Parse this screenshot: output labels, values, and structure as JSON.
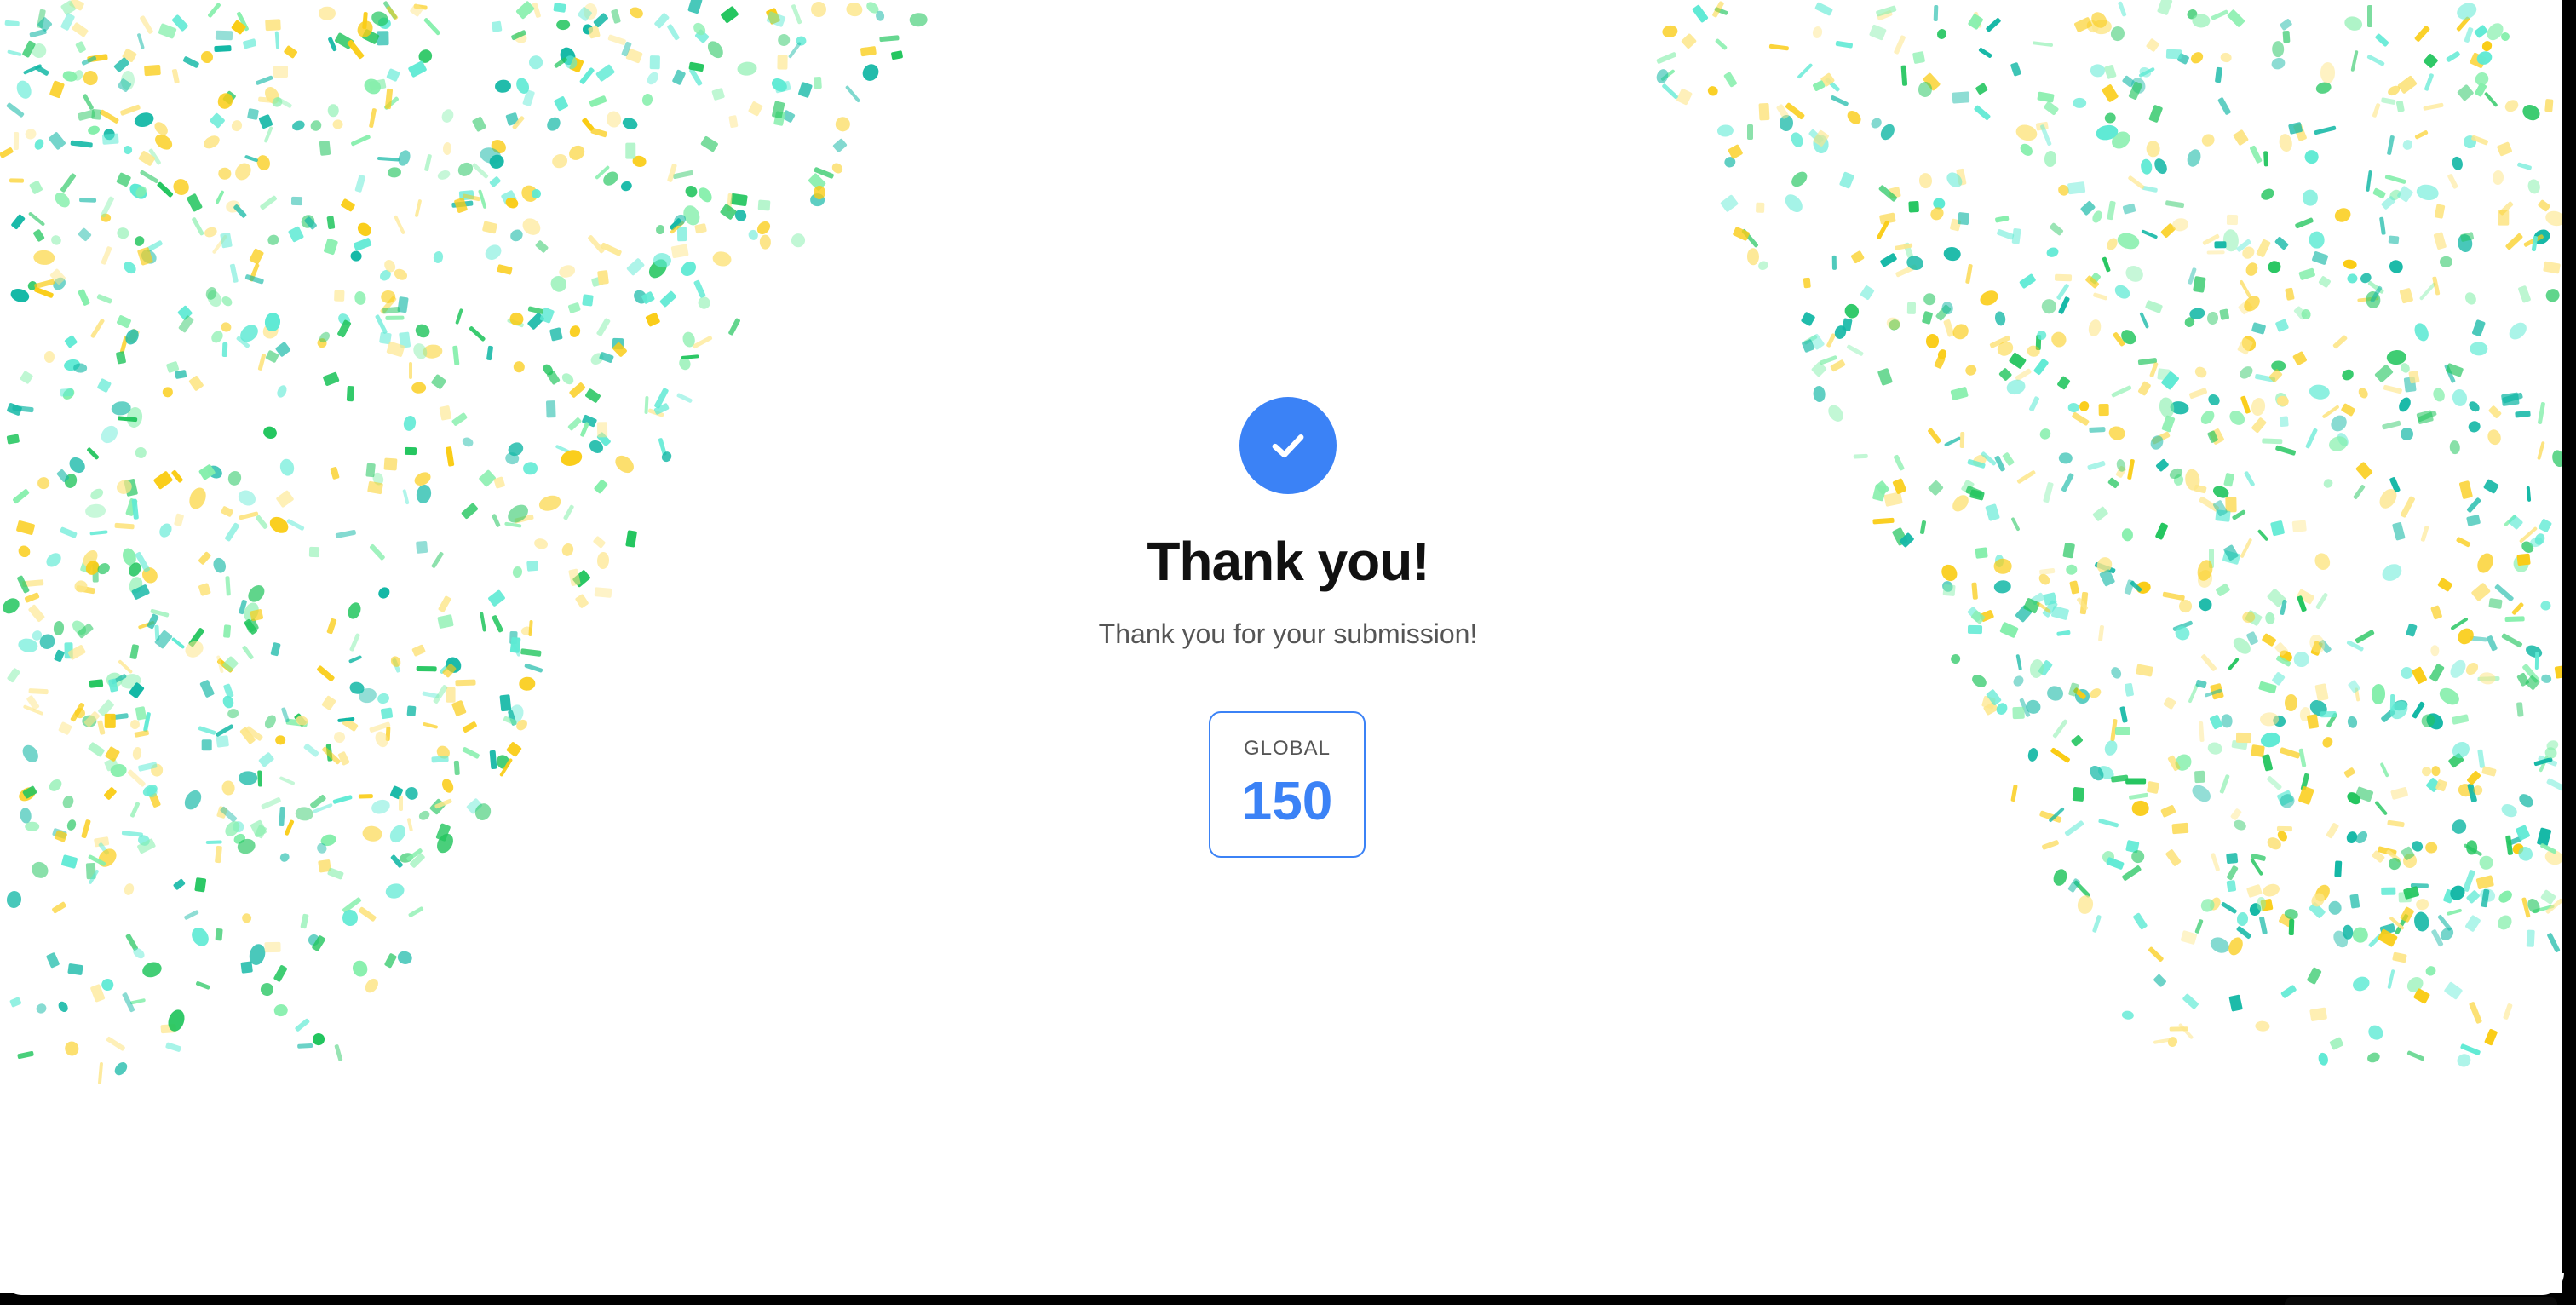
{
  "icons": {
    "success": "check-icon"
  },
  "success": {
    "title": "Thank you!",
    "message": "Thank you for your submission!"
  },
  "stat": {
    "label": "GLOBAL",
    "value": "150"
  },
  "colors": {
    "accent": "#3b82f6",
    "confetti": [
      "#22c55e",
      "#14b8a6",
      "#facc15",
      "#86efac",
      "#5eead4",
      "#fde68a"
    ]
  }
}
